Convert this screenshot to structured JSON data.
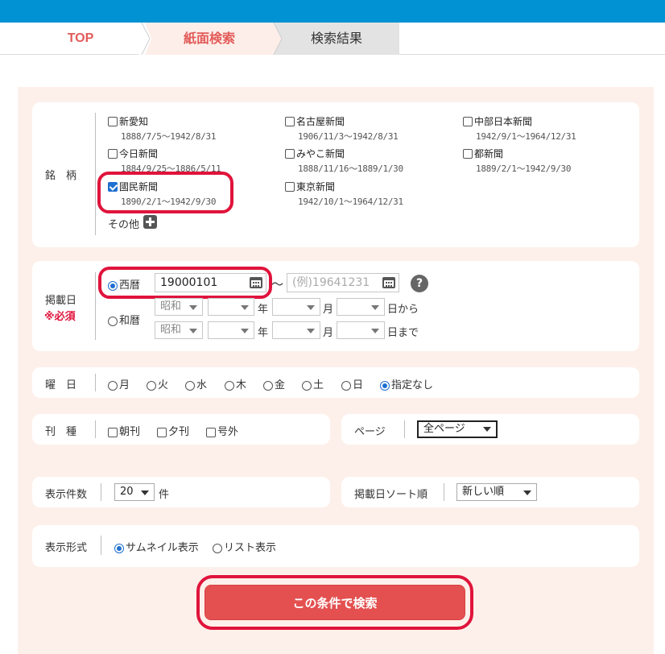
{
  "breadcrumb": {
    "top": "TOP",
    "paper_search": "紙面検索",
    "search_results": "検索結果"
  },
  "brand_section": {
    "label": "銘　柄",
    "items": [
      {
        "name": "新愛知",
        "period": "1888/7/5〜1942/8/31",
        "checked": false
      },
      {
        "name": "名古屋新聞",
        "period": "1906/11/3〜1942/8/31",
        "checked": false
      },
      {
        "name": "中部日本新聞",
        "period": "1942/9/1〜1964/12/31",
        "checked": false
      },
      {
        "name": "今日新聞",
        "period": "1884/9/25〜1886/5/11",
        "checked": false
      },
      {
        "name": "みやこ新聞",
        "period": "1888/11/16〜1889/1/30",
        "checked": false
      },
      {
        "name": "都新聞",
        "period": "1889/2/1〜1942/9/30",
        "checked": false
      },
      {
        "name": "國民新聞",
        "period": "1890/2/1〜1942/9/30",
        "checked": true
      },
      {
        "name": "東京新聞",
        "period": "1942/10/1〜1964/12/31",
        "checked": false
      }
    ],
    "other_label": "その他",
    "other_icon": "plus-icon"
  },
  "date_section": {
    "label": "掲載日",
    "required": "※必須",
    "western_label": "西暦",
    "western_from_value": "19000101",
    "western_to_placeholder": "(例)19641231",
    "range_separator": "〜",
    "help": "?",
    "japanese_label": "和暦",
    "era_value": "昭和",
    "year_unit": "年",
    "month_unit": "月",
    "from_suffix": "日から",
    "to_suffix": "日まで"
  },
  "weekday_section": {
    "label": "曜　日",
    "options": [
      "月",
      "火",
      "水",
      "木",
      "金",
      "土",
      "日",
      "指定なし"
    ],
    "selected": "指定なし"
  },
  "edition_section": {
    "label": "刊　種",
    "options": [
      "朝刊",
      "夕刊",
      "号外"
    ]
  },
  "page_section": {
    "label": "ページ",
    "value": "全ページ"
  },
  "count_section": {
    "label": "表示件数",
    "value": "20",
    "unit": "件"
  },
  "sort_section": {
    "label": "掲載日ソート順",
    "value": "新しい順"
  },
  "format_section": {
    "label": "表示形式",
    "options": [
      "サムネイル表示",
      "リスト表示"
    ],
    "selected": "サムネイル表示"
  },
  "submit_label": "この条件で検索",
  "colors": {
    "top_bar": "#0092d3",
    "accent_red": "#e25b59",
    "submit": "#e45050",
    "highlight_ring": "#e0143c",
    "panel_bg": "#fdf0ea"
  }
}
